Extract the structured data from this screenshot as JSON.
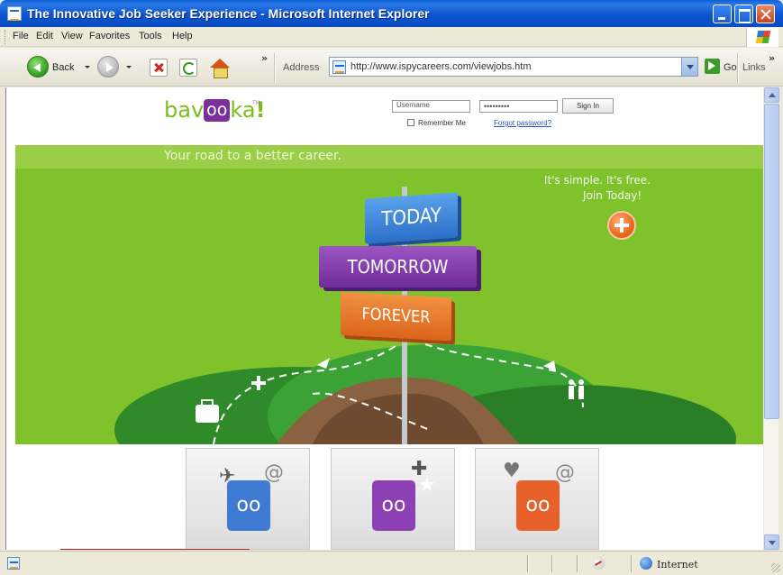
{
  "window": {
    "title": "The Innovative Job Seeker Experience - Microsoft Internet Explorer"
  },
  "menu": {
    "items": [
      "File",
      "Edit",
      "View",
      "Favorites",
      "Tools",
      "Help"
    ]
  },
  "toolbar": {
    "back_label": "Back",
    "address_label": "Address",
    "address_value": "http://www.ispycareers.com/viewjobs.htm",
    "go_label": "Go",
    "links_label": "Links",
    "chevron": "»"
  },
  "page": {
    "logo": {
      "part1": "bav",
      "part2": "oo",
      "part3": "ka",
      "part4": "!",
      "tm": "TM"
    },
    "login": {
      "username_value": "Username",
      "password_value": "•••••••••",
      "sign_in_label": "Sign In",
      "remember_label": "Remember Me",
      "forgot_label": "Forgot password?"
    },
    "tagline": "Your road to a better career.",
    "join": {
      "line1": "It's simple. It's free.",
      "line2": "Join Today!"
    },
    "signs": {
      "today": "TODAY",
      "tomorrow": "TOMORROW",
      "forever": "FOREVER"
    },
    "cards": [
      {
        "badge": "oo",
        "color": "#3f7bd2"
      },
      {
        "badge": "oo",
        "color": "#8d3fb6"
      },
      {
        "badge": "oo",
        "color": "#e8612b"
      }
    ]
  },
  "status": {
    "zone_label": "Internet"
  },
  "colors": {
    "brand_green": "#7cbd1e",
    "hero_green": "#7fc22c",
    "brand_purple": "#7a2f9a",
    "link_blue": "#2a55c2"
  },
  "icons": {
    "title": "ie-page-icon",
    "back": "back-arrow-icon",
    "forward": "forward-arrow-icon",
    "stop": "stop-icon",
    "refresh": "refresh-icon",
    "home": "home-icon",
    "go": "go-arrow-icon",
    "join": "plus-circle-icon",
    "status_zone": "globe-icon"
  }
}
